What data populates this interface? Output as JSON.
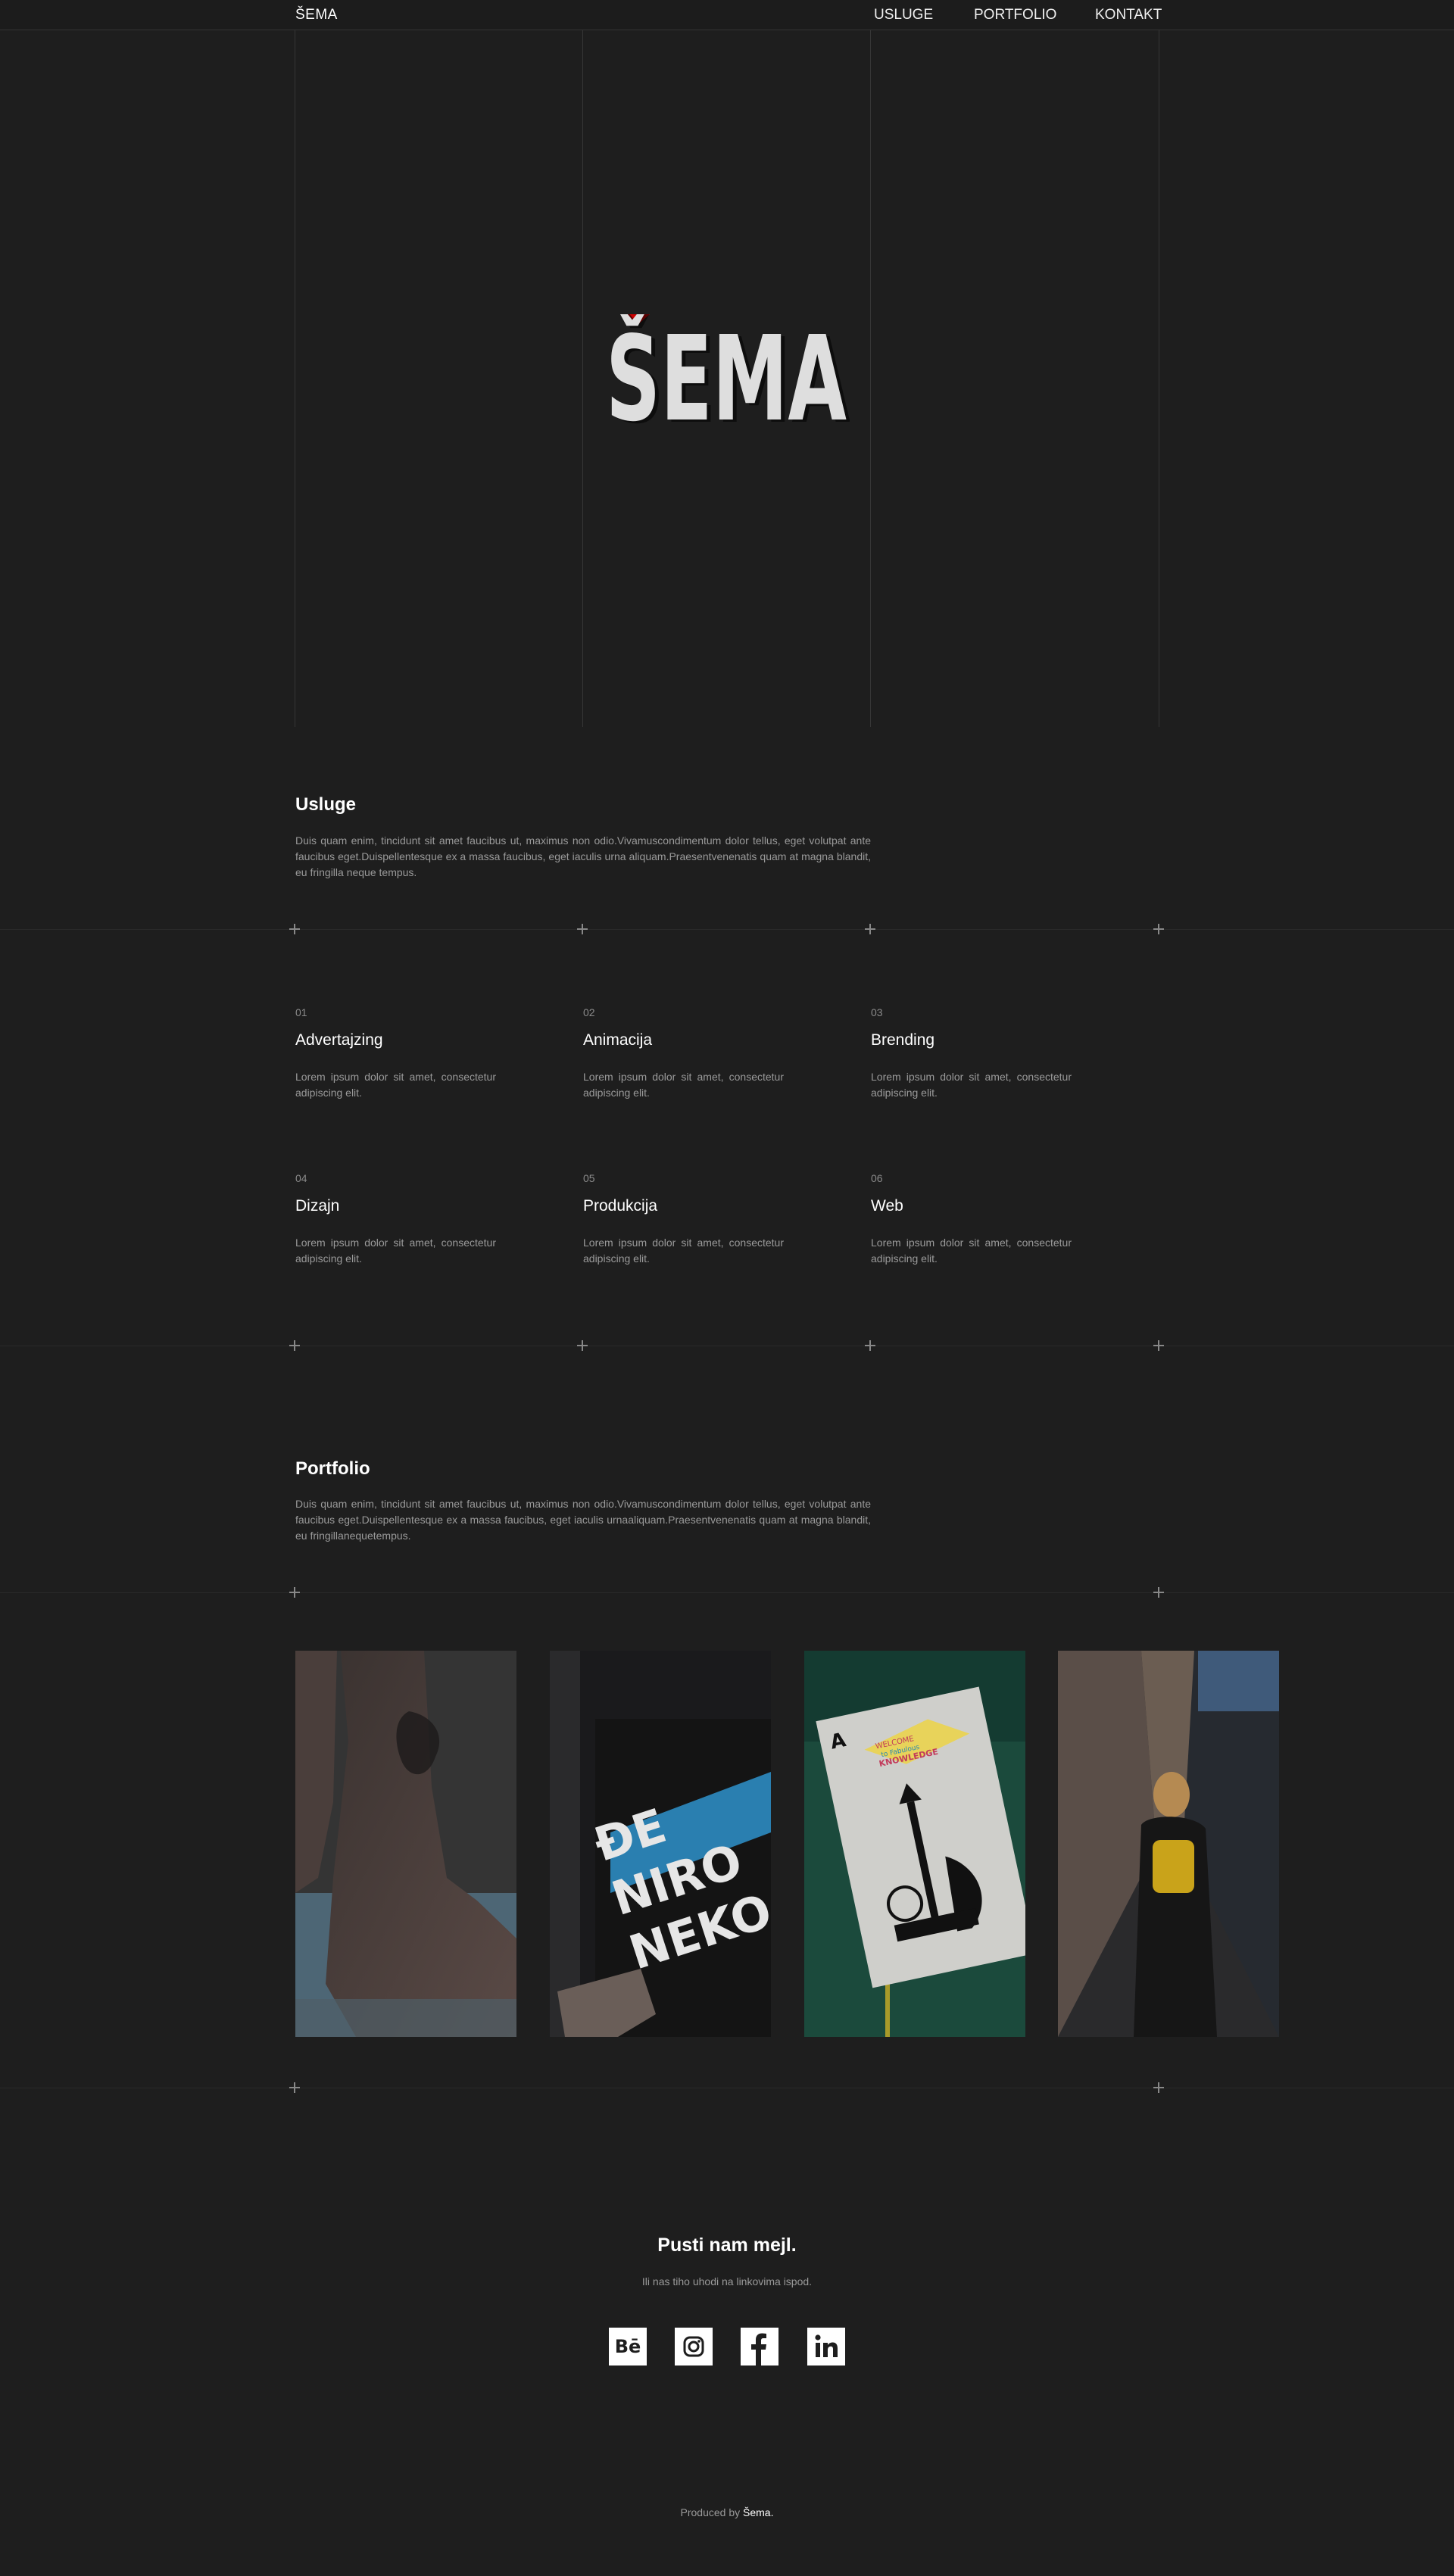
{
  "header": {
    "brand": "ŠEMA",
    "nav": [
      {
        "label": "USLUGE"
      },
      {
        "label": "PORTFOLIO"
      },
      {
        "label": "KONTAKT"
      }
    ]
  },
  "hero": {
    "logo_text": "ŠEMA"
  },
  "services": {
    "title": "Usluge",
    "text": "Duis quam enim, tincidunt sit amet faucibus ut, maximus non odio.Vivamuscondimentum dolor tellus, eget volutpat ante faucibus eget.Duispellentesque ex a massa faucibus, eget iaculis urna aliquam.Praesentvenenatis quam at magna blandit, eu fringilla neque tempus.",
    "items": [
      {
        "num": "01",
        "title": "Advertajzing",
        "desc": "Lorem ipsum dolor sit amet, consectetur adipiscing elit."
      },
      {
        "num": "02",
        "title": "Animacija",
        "desc": "Lorem ipsum dolor sit amet, consectetur adipiscing elit."
      },
      {
        "num": "03",
        "title": "Brending",
        "desc": "Lorem ipsum dolor sit amet, consectetur adipiscing elit."
      },
      {
        "num": "04",
        "title": "Dizajn",
        "desc": "Lorem ipsum dolor sit amet, consectetur adipiscing elit."
      },
      {
        "num": "05",
        "title": "Produkcija",
        "desc": "Lorem ipsum dolor sit amet, consectetur adipiscing elit."
      },
      {
        "num": "06",
        "title": "Web",
        "desc": "Lorem ipsum dolor sit amet, consectetur adipiscing elit."
      }
    ]
  },
  "portfolio": {
    "title": "Portfolio",
    "text": "Duis quam enim, tincidunt sit amet faucibus ut, maximus non odio.Vivamuscondimentum dolor tellus, eget volutpat ante faucibus eget.Duispellentesque ex a massa faucibus, eget iaculis urnaaliquam.Praesentvenenatis quam at magna blandit, eu fringillanequetempus.",
    "shirt_text": [
      "ĐE",
      "NIRO",
      "NEKO"
    ],
    "card_text": {
      "rank": "A",
      "welcome": "WELCOME",
      "line1": "to Fabulous",
      "line2": "KNOWLEDGE"
    }
  },
  "contact": {
    "title": "Pusti nam mejl.",
    "subtitle": "Ili nas tiho uhodi na linkovima ispod.",
    "behance_label": "Bē"
  },
  "footer": {
    "prefix": "Produced by",
    "brand": "Šema."
  },
  "colors": {
    "background": "#1e1e1e",
    "accent_red": "#cc0000",
    "text_muted": "#9a9a9a"
  }
}
